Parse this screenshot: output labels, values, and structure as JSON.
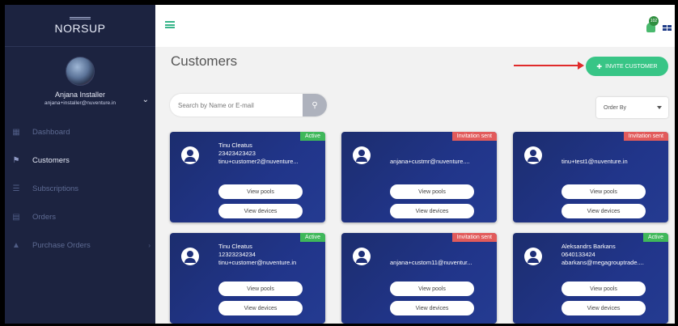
{
  "app": {
    "logo": "NORSUP"
  },
  "user": {
    "name": "Anjana Installer",
    "email": "anjana+installer@nuventure.in"
  },
  "nav": [
    {
      "label": "Dashboard",
      "icon": "dashboard-icon"
    },
    {
      "label": "Customers",
      "icon": "customers-icon"
    },
    {
      "label": "Subscriptions",
      "icon": "subscriptions-icon"
    },
    {
      "label": "Orders",
      "icon": "orders-icon"
    },
    {
      "label": "Purchase Orders",
      "icon": "purchase-orders-icon"
    }
  ],
  "topbar": {
    "notification_count": "102"
  },
  "page": {
    "title": "Customers",
    "invite_label": "INVITE CUSTOMER",
    "search_placeholder": "Search by Name or E-mail",
    "orderby_label": "Order By"
  },
  "colors": {
    "accent": "#38c586",
    "sidebar": "#1c2340",
    "card": "#21358a",
    "active": "#3fb85a",
    "invited": "#e25b5b"
  },
  "cards": [
    {
      "status": "Active",
      "name": "Tinu Cleatus",
      "phone": "23423423423",
      "email": "tinu+customer2@nuventure...",
      "btn_pools": "View pools",
      "btn_devices": "View devices"
    },
    {
      "status": "Invitation sent",
      "name": "",
      "phone": "",
      "email": "anjana+custmr@nuventure....",
      "btn_pools": "View pools",
      "btn_devices": "View devices"
    },
    {
      "status": "Invitation sent",
      "name": "",
      "phone": "",
      "email": "tinu+test1@nuventure.in",
      "btn_pools": "View pools",
      "btn_devices": "View devices"
    },
    {
      "status": "Active",
      "name": "Tinu Cleatus",
      "phone": "12323234234",
      "email": "tinu+customer@nuventure.in",
      "btn_pools": "View pools",
      "btn_devices": "View devices"
    },
    {
      "status": "Invitation sent",
      "name": "",
      "phone": "",
      "email": "anjana+custom11@nuventur...",
      "btn_pools": "View pools",
      "btn_devices": "View devices"
    },
    {
      "status": "Active",
      "name": "Aleksandrs Barkans",
      "phone": "0640133424",
      "email": "abarkans@megagrouptrade....",
      "btn_pools": "View pools",
      "btn_devices": "View devices"
    }
  ]
}
